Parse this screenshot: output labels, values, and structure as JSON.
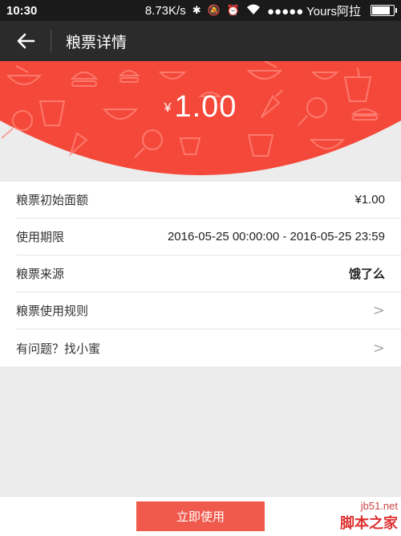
{
  "status_bar": {
    "time": "10:30",
    "speed": "8.73K/s",
    "carrier": "●●●●● Yours阿拉",
    "battery_level": 0.85
  },
  "header": {
    "title": "粮票详情"
  },
  "banner": {
    "currency_symbol": "¥",
    "amount": "1.00",
    "color": "#f4493a"
  },
  "details": {
    "rows": [
      {
        "label": "粮票初始面额",
        "value": "¥1.00"
      },
      {
        "label": "使用期限",
        "value": "2016-05-25 00:00:00 - 2016-05-25 23:59"
      },
      {
        "label": "粮票来源",
        "value": "饿了么"
      },
      {
        "label": "粮票使用规则"
      },
      {
        "label": "有问题？找小蜜"
      }
    ]
  },
  "bottom": {
    "use_button": "立即使用",
    "accent": "#ef5a4d"
  },
  "watermark": {
    "site": "jb51.net",
    "name": "脚本之家"
  }
}
